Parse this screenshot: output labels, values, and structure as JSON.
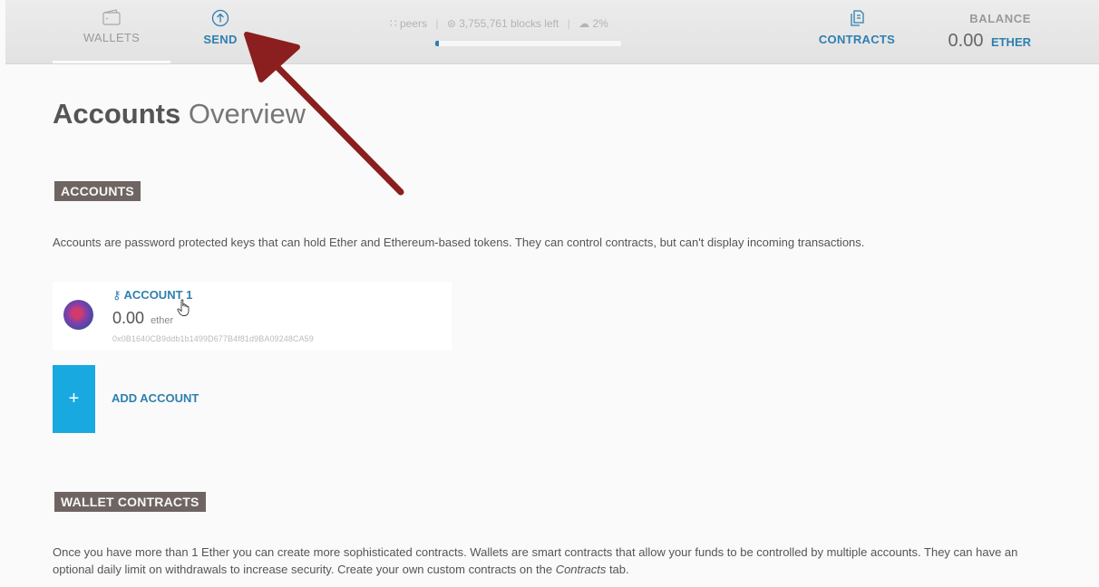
{
  "nav": {
    "wallets_label": "WALLETS",
    "send_label": "SEND",
    "contracts_label": "CONTRACTS"
  },
  "status": {
    "peers": "peers",
    "blocks_left": "3,755,761 blocks left",
    "sync_percent": "2%",
    "progress_fraction": 0.02
  },
  "balance": {
    "title": "BALANCE",
    "amount": "0.00",
    "unit": "ETHER"
  },
  "page": {
    "title_bold": "Accounts",
    "title_light": "Overview"
  },
  "accounts_section": {
    "heading": "ACCOUNTS",
    "description": "Accounts are password protected keys that can hold Ether and Ethereum-based tokens. They can control contracts, but can't display incoming transactions.",
    "accounts": [
      {
        "name": "ACCOUNT 1",
        "balance": "0.00",
        "unit": "ether",
        "address": "0x0B1640CB9ddb1b1499D677B4f81d9BA09248CA59"
      }
    ],
    "add_label": "ADD ACCOUNT",
    "add_symbol": "+"
  },
  "wallets_section": {
    "heading": "WALLET CONTRACTS",
    "description_prefix": "Once you have more than 1 Ether you can create more sophisticated contracts. Wallets are smart contracts that allow your funds to be controlled by multiple accounts. They can have an optional daily limit on withdrawals to increase security. Create your own custom contracts on the ",
    "description_link": "Contracts",
    "description_suffix": " tab."
  },
  "colors": {
    "accent": "#2f7fb0",
    "add_button": "#19a9e1",
    "badge_bg": "#6e6563",
    "annotation_arrow": "#8b1e1e"
  },
  "icons": {
    "wallets": "wallet-icon",
    "send": "send-icon",
    "contracts": "contracts-icon",
    "account_key": "key-icon",
    "cursor": "hand-pointer-icon",
    "annotation": "annotation-arrow-icon"
  }
}
